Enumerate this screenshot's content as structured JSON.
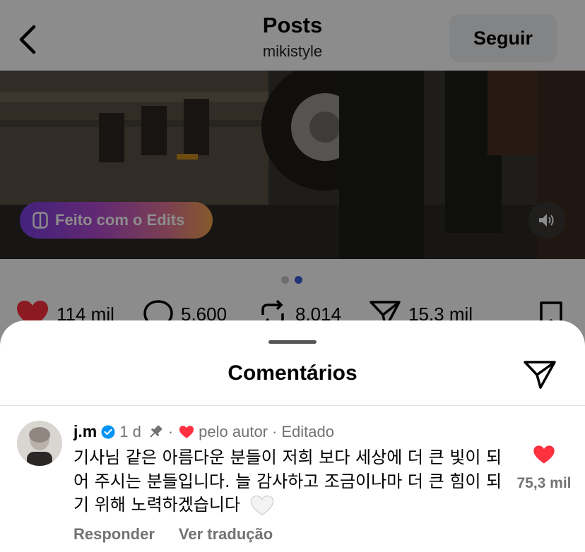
{
  "header": {
    "title": "Posts",
    "subtitle": "mikistyle",
    "follow_label": "Seguir"
  },
  "media": {
    "edits_label": "Feito com o Edits"
  },
  "actions": {
    "likes": "114 mil",
    "comments": "5.600",
    "reposts": "8.014",
    "shares": "15,3 mil"
  },
  "sheet": {
    "title": "Comentários"
  },
  "comment": {
    "username": "j.m",
    "time": "1 d",
    "dot": "·",
    "liked_by": "pelo autor",
    "edited": "Editado",
    "text": "기사님 같은 아름다운 분들이 저희 보다 세상에 더 큰 빛이 되어 주시는 분들입니다. 늘 감사하고 조금이나마 더 큰 힘이 되기 위해 노력하겠습니다",
    "like_count": "75,3 mil",
    "reply_label": "Responder",
    "translate_label": "Ver tradução"
  },
  "colors": {
    "accent": "#3b5bdb",
    "like_red": "#ff3040",
    "muted": "#737373"
  },
  "icons": [
    "back-arrow-icon",
    "edits-icon",
    "speaker-icon",
    "heart-icon",
    "comment-icon",
    "repost-icon",
    "share-icon",
    "bookmark-icon",
    "send-icon",
    "verified-icon",
    "pin-icon",
    "white-heart-icon"
  ]
}
